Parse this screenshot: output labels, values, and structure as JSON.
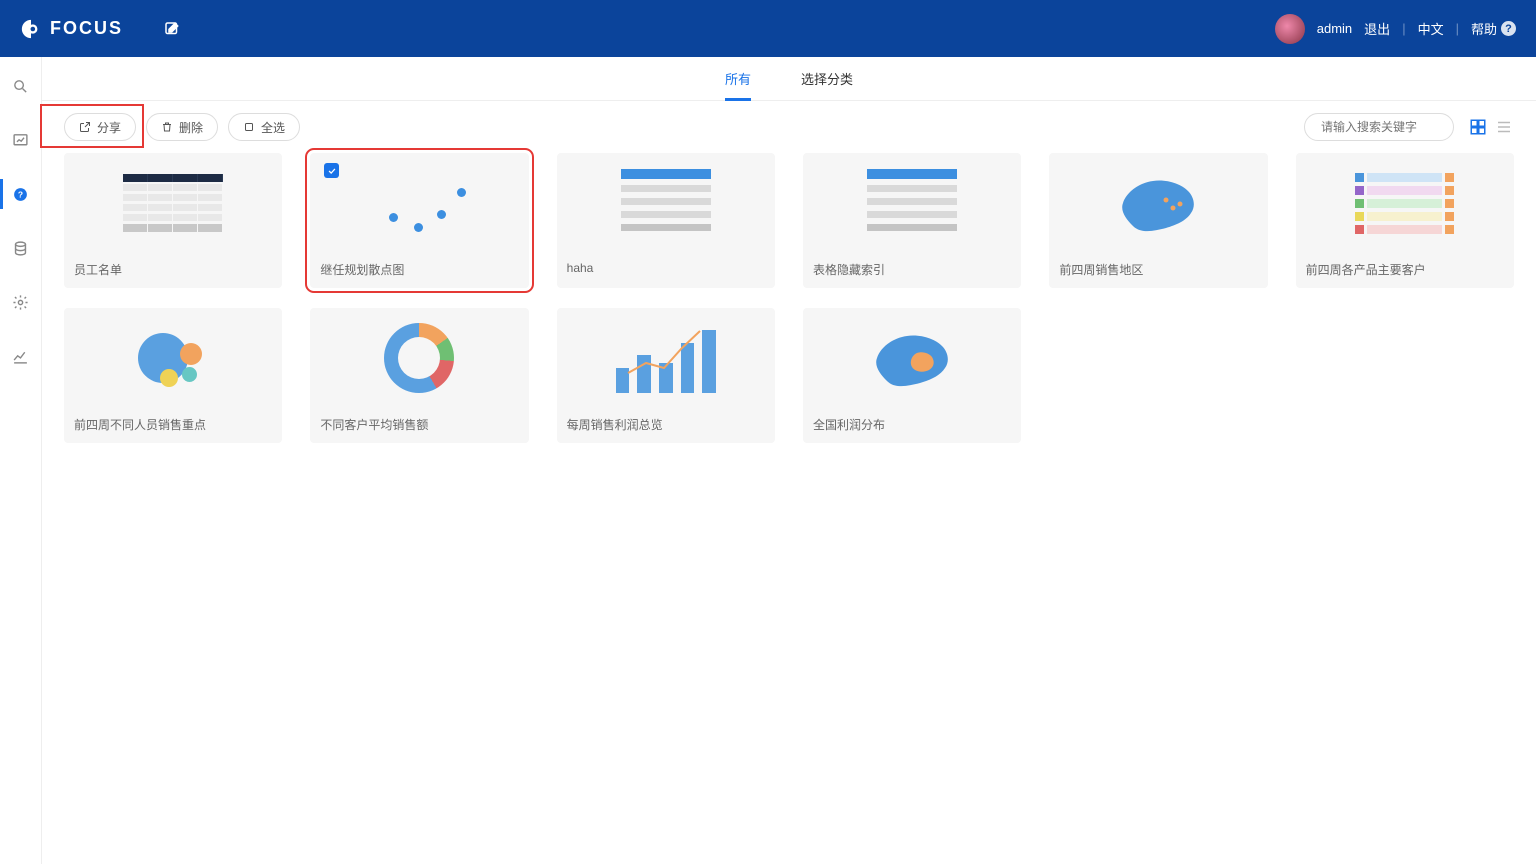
{
  "header": {
    "brand": "FOCUS",
    "user": "admin",
    "logout": "退出",
    "language": "中文",
    "help": "帮助"
  },
  "tabs": {
    "all": "所有",
    "category": "选择分类"
  },
  "toolbar": {
    "share": "分享",
    "delete": "删除",
    "select_all": "全选",
    "search_placeholder": "请输入搜索关键字"
  },
  "cards": [
    {
      "title": "员工名单",
      "type": "table",
      "selected": false
    },
    {
      "title": "继任规划散点图",
      "type": "scatter",
      "selected": true
    },
    {
      "title": "haha",
      "type": "list",
      "selected": false
    },
    {
      "title": "表格隐藏索引",
      "type": "list",
      "selected": false
    },
    {
      "title": "前四周销售地区",
      "type": "map_blue",
      "selected": false
    },
    {
      "title": "前四周各产品主要客户",
      "type": "colorlist",
      "selected": false
    },
    {
      "title": "前四周不同人员销售重点",
      "type": "bubble",
      "selected": false
    },
    {
      "title": "不同客户平均销售额",
      "type": "donut",
      "selected": false
    },
    {
      "title": "每周销售利润总览",
      "type": "barline",
      "selected": false
    },
    {
      "title": "全国利润分布",
      "type": "map_orange",
      "selected": false
    }
  ],
  "colors": {
    "brand": "#0b449b",
    "accent": "#1a73e8",
    "highlight": "#e53935"
  }
}
